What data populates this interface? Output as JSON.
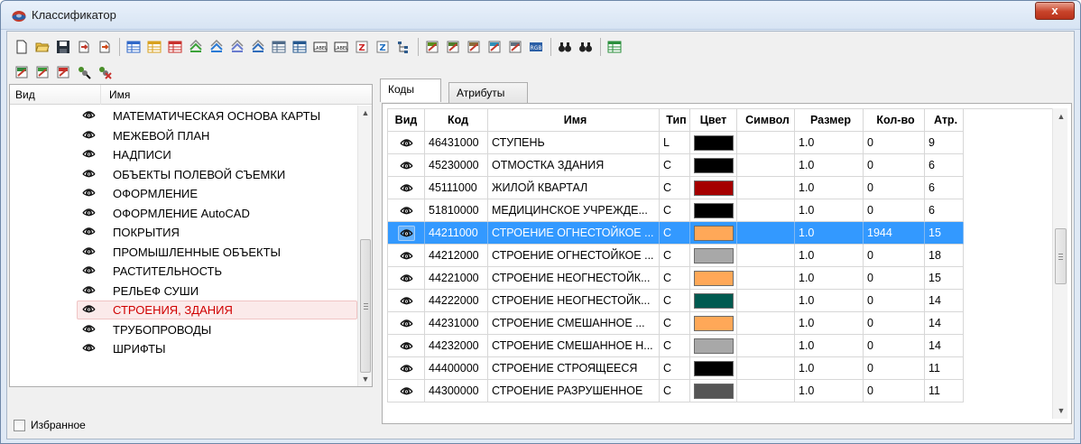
{
  "window": {
    "title": "Классификатор",
    "close_label": "x"
  },
  "toolbar": {
    "row1": [
      {
        "icon": "new-file-icon"
      },
      {
        "icon": "open-folder-icon"
      },
      {
        "icon": "save-icon"
      },
      {
        "icon": "import-icon"
      },
      {
        "icon": "export-icon"
      },
      {
        "icon": "table-blue-icon"
      },
      {
        "icon": "table-yellow-icon"
      },
      {
        "icon": "table-red-icon"
      },
      {
        "icon": "layers-green-icon"
      },
      {
        "icon": "layers-blue-icon"
      },
      {
        "icon": "layers-dashed-icon"
      },
      {
        "icon": "layers-check-icon"
      },
      {
        "icon": "table-add-icon"
      },
      {
        "icon": "table-rows-icon"
      },
      {
        "icon": "label-icon"
      },
      {
        "icon": "label-stack-icon"
      },
      {
        "icon": "z-icon"
      },
      {
        "icon": "sort-z-icon"
      },
      {
        "icon": "tree-icon"
      },
      {
        "icon": "edit-pencil-icon"
      },
      {
        "icon": "doc-edit-icon"
      },
      {
        "icon": "doc-icon"
      },
      {
        "icon": "doc-image-icon"
      },
      {
        "icon": "doc-page-icon"
      },
      {
        "icon": "rgb-icon"
      },
      {
        "icon": "binoculars-icon"
      },
      {
        "icon": "binoculars-text-icon"
      },
      {
        "icon": "table-edit-icon"
      }
    ],
    "row2": [
      {
        "icon": "layer-edit-icon"
      },
      {
        "icon": "layer-add-icon"
      },
      {
        "icon": "layer-remove-icon"
      },
      {
        "icon": "show-all-icon"
      },
      {
        "icon": "hide-all-icon"
      }
    ]
  },
  "left_panel": {
    "header_vid": "Вид",
    "header_name": "Имя",
    "items": [
      {
        "label": "МАТЕМАТИЧЕСКАЯ ОСНОВА КАРТЫ",
        "selected": false
      },
      {
        "label": "МЕЖЕВОЙ ПЛАН",
        "selected": false
      },
      {
        "label": "НАДПИСИ",
        "selected": false
      },
      {
        "label": "ОБЪЕКТЫ ПОЛЕВОЙ СЪЕМКИ",
        "selected": false
      },
      {
        "label": "ОФОРМЛЕНИЕ",
        "selected": false
      },
      {
        "label": "ОФОРМЛЕНИЕ AutoCAD",
        "selected": false
      },
      {
        "label": "ПОКРЫТИЯ",
        "selected": false
      },
      {
        "label": "ПРОМЫШЛЕННЫЕ ОБЪЕКТЫ",
        "selected": false
      },
      {
        "label": "РАСТИТЕЛЬНОСТЬ",
        "selected": false
      },
      {
        "label": "РЕЛЬЕФ  СУШИ",
        "selected": false
      },
      {
        "label": "СТРОЕНИЯ, ЗДАНИЯ",
        "selected": true
      },
      {
        "label": "ТРУБОПРОВОДЫ",
        "selected": false
      },
      {
        "label": "ШРИФТЫ",
        "selected": false
      }
    ],
    "favorites_label": "Избранное"
  },
  "tabs": [
    {
      "label": "Коды",
      "active": true
    },
    {
      "label": "Атрибуты",
      "active": false
    }
  ],
  "codes_table": {
    "headers": [
      "Вид",
      "Код",
      "Имя",
      "Тип",
      "Цвет",
      "Символ",
      "Размер",
      "Кол-во",
      "Атр."
    ],
    "rows": [
      {
        "code": "46431000",
        "name": "СТУПЕНЬ",
        "type": "L",
        "color": "#000000",
        "symbol": "",
        "size": "1.0",
        "count": "0",
        "attr": "9",
        "selected": false
      },
      {
        "code": "45230000",
        "name": "ОТМОСТКА ЗДАНИЯ",
        "type": "C",
        "color": "#000000",
        "symbol": "",
        "size": "1.0",
        "count": "0",
        "attr": "6",
        "selected": false
      },
      {
        "code": "45111000",
        "name": "ЖИЛОЙ КВАРТАЛ",
        "type": "C",
        "color": "#a50000",
        "symbol": "",
        "size": "1.0",
        "count": "0",
        "attr": "6",
        "selected": false
      },
      {
        "code": "51810000",
        "name": "МЕДИЦИНСКОЕ УЧРЕЖДЕ...",
        "type": "C",
        "color": "#000000",
        "symbol": "",
        "size": "1.0",
        "count": "0",
        "attr": "6",
        "selected": false
      },
      {
        "code": "44211000",
        "name": "СТРОЕНИЕ ОГНЕСТОЙКОЕ ...",
        "type": "C",
        "color": "#ffa858",
        "symbol": "",
        "size": "1.0",
        "count": "1944",
        "attr": "15",
        "selected": true
      },
      {
        "code": "44212000",
        "name": "СТРОЕНИЕ ОГНЕСТОЙКОЕ ...",
        "type": "C",
        "color": "#a8a8a8",
        "symbol": "",
        "size": "1.0",
        "count": "0",
        "attr": "18",
        "selected": false
      },
      {
        "code": "44221000",
        "name": "СТРОЕНИЕ НЕОГНЕСТОЙК...",
        "type": "C",
        "color": "#ffa858",
        "symbol": "",
        "size": "1.0",
        "count": "0",
        "attr": "15",
        "selected": false
      },
      {
        "code": "44222000",
        "name": "СТРОЕНИЕ НЕОГНЕСТОЙК...",
        "type": "C",
        "color": "#005a50",
        "symbol": "",
        "size": "1.0",
        "count": "0",
        "attr": "14",
        "selected": false
      },
      {
        "code": "44231000",
        "name": "СТРОЕНИЕ СМЕШАННОЕ ...",
        "type": "C",
        "color": "#ffa858",
        "symbol": "",
        "size": "1.0",
        "count": "0",
        "attr": "14",
        "selected": false
      },
      {
        "code": "44232000",
        "name": "СТРОЕНИЕ СМЕШАННОЕ Н...",
        "type": "C",
        "color": "#a8a8a8",
        "symbol": "",
        "size": "1.0",
        "count": "0",
        "attr": "14",
        "selected": false
      },
      {
        "code": "44400000",
        "name": "СТРОЕНИЕ СТРОЯЩЕЕСЯ",
        "type": "C",
        "color": "#000000",
        "symbol": "",
        "size": "1.0",
        "count": "0",
        "attr": "11",
        "selected": false
      },
      {
        "code": "44300000",
        "name": "СТРОЕНИЕ РАЗРУШЕННОЕ",
        "type": "C",
        "color": "#555555",
        "symbol": "",
        "size": "1.0",
        "count": "0",
        "attr": "11",
        "selected": false
      }
    ]
  }
}
